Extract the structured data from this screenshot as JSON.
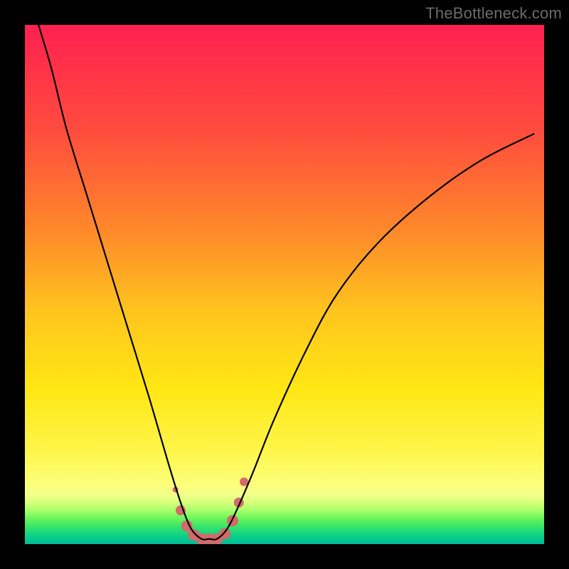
{
  "watermark": "TheBottleneck.com",
  "chart_data": {
    "type": "line",
    "title": "",
    "xlabel": "",
    "ylabel": "",
    "xlim": [
      0,
      100
    ],
    "ylim": [
      0,
      100
    ],
    "grid": false,
    "series": [
      {
        "name": "bottleneck-curve",
        "x": [
          2,
          5,
          8,
          12,
          16,
          20,
          24,
          27.5,
          30,
          32,
          34,
          35.5,
          37,
          39,
          41,
          44,
          48,
          54,
          60,
          68,
          78,
          88,
          98
        ],
        "y": [
          102,
          92,
          80,
          67,
          54,
          41,
          28,
          16,
          8,
          3,
          1,
          1,
          1,
          3,
          7,
          14,
          24,
          37,
          48,
          58,
          67,
          74,
          79
        ]
      }
    ],
    "markers": {
      "name": "bottom-dots",
      "color": "#d46a6a",
      "points": [
        {
          "x": 29.0,
          "y": 10.5,
          "r": 4
        },
        {
          "x": 30.0,
          "y": 6.5,
          "r": 7
        },
        {
          "x": 31.2,
          "y": 3.5,
          "r": 8
        },
        {
          "x": 32.5,
          "y": 1.8,
          "r": 8
        },
        {
          "x": 34.0,
          "y": 1.0,
          "r": 8
        },
        {
          "x": 35.5,
          "y": 1.0,
          "r": 8
        },
        {
          "x": 37.0,
          "y": 1.0,
          "r": 8
        },
        {
          "x": 38.5,
          "y": 2.0,
          "r": 8
        },
        {
          "x": 40.0,
          "y": 4.5,
          "r": 8
        },
        {
          "x": 41.2,
          "y": 8.0,
          "r": 7
        },
        {
          "x": 42.2,
          "y": 12.0,
          "r": 6
        }
      ]
    },
    "gradient_stops": [
      {
        "offset": 0.0,
        "color": "#ff2050"
      },
      {
        "offset": 0.2,
        "color": "#ff4b3e"
      },
      {
        "offset": 0.4,
        "color": "#ff8a2a"
      },
      {
        "offset": 0.55,
        "color": "#ffc41e"
      },
      {
        "offset": 0.7,
        "color": "#ffe714"
      },
      {
        "offset": 0.82,
        "color": "#fff54a"
      },
      {
        "offset": 0.885,
        "color": "#fcff7a"
      },
      {
        "offset": 0.905,
        "color": "#f2ff8a"
      },
      {
        "offset": 0.92,
        "color": "#d6ff7a"
      },
      {
        "offset": 0.935,
        "color": "#a8ff6a"
      },
      {
        "offset": 0.95,
        "color": "#6cf55a"
      },
      {
        "offset": 0.965,
        "color": "#3de56a"
      },
      {
        "offset": 0.978,
        "color": "#18d87e"
      },
      {
        "offset": 0.99,
        "color": "#04c98f"
      },
      {
        "offset": 1.0,
        "color": "#00bd96"
      }
    ]
  }
}
